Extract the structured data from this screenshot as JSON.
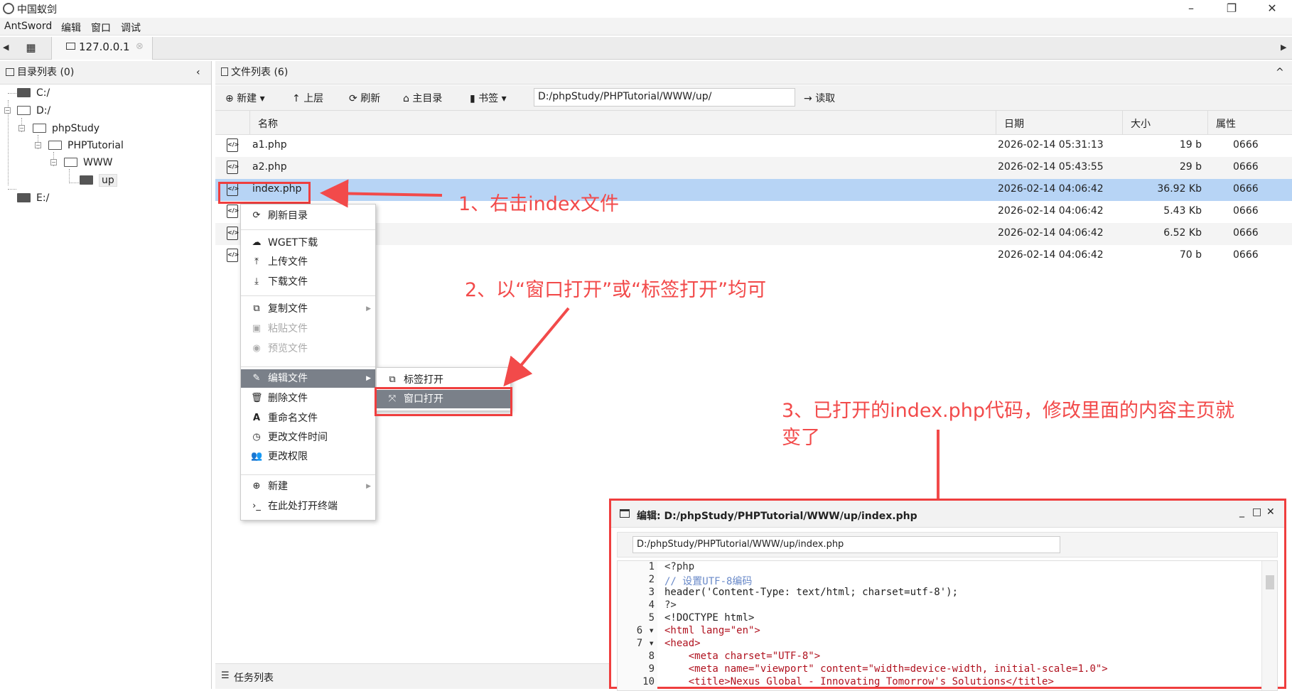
{
  "window": {
    "title": "中国蚁剑",
    "minimize": "–",
    "restore": "❐",
    "close": "✕"
  },
  "menu": [
    "AntSword",
    "编辑",
    "窗口",
    "调试"
  ],
  "tabs": {
    "host": "127.0.0.1"
  },
  "left": {
    "header": "目录列表 (0)",
    "tree": [
      "C:/",
      "D:/",
      "phpStudy",
      "PHPTutorial",
      "WWW",
      "up",
      "E:/"
    ]
  },
  "right": {
    "header": "文件列表 (6)",
    "toolbar": {
      "new": "新建",
      "up": "上层",
      "refresh": "刷新",
      "home": "主目录",
      "bookmark": "书签",
      "path": "D:/phpStudy/PHPTutorial/WWW/up/",
      "read": "读取"
    },
    "columns": [
      "名称",
      "日期",
      "大小",
      "属性"
    ],
    "files": [
      {
        "name": "a1.php",
        "date": "2026-02-14 05:31:13",
        "size": "19 b",
        "attr": "0666"
      },
      {
        "name": "a2.php",
        "date": "2026-02-14 05:43:55",
        "size": "29 b",
        "attr": "0666"
      },
      {
        "name": "index.php",
        "date": "2026-02-14 04:06:42",
        "size": "36.92 Kb",
        "attr": "0666"
      },
      {
        "name": "",
        "date": "2026-02-14 04:06:42",
        "size": "5.43 Kb",
        "attr": "0666"
      },
      {
        "name": "",
        "date": "2026-02-14 04:06:42",
        "size": "6.52 Kb",
        "attr": "0666"
      },
      {
        "name": "",
        "date": "2026-02-14 04:06:42",
        "size": "70 b",
        "attr": "0666"
      }
    ]
  },
  "context_menu": {
    "items": [
      "刷新目录",
      "WGET下载",
      "上传文件",
      "下载文件",
      "复制文件",
      "粘贴文件",
      "预览文件",
      "编辑文件",
      "删除文件",
      "重命名文件",
      "更改文件时间",
      "更改权限",
      "新建",
      "在此处打开终端"
    ],
    "submenu": [
      "标签打开",
      "窗口打开"
    ]
  },
  "annotations": {
    "step1": "1、右击index文件",
    "step2": "2、以“窗口打开”或“标签打开”均可",
    "step3_line1": "3、已打开的index.php代码，修改里面的内容主页就",
    "step3_line2": "变了"
  },
  "editor": {
    "title": "编辑: D:/phpStudy/PHPTutorial/WWW/up/index.php",
    "path": "D:/phpStudy/PHPTutorial/WWW/up/index.php",
    "lines": [
      "<?php",
      "// 设置UTF-8编码",
      "header('Content-Type: text/html; charset=utf-8');",
      "?>",
      "<!DOCTYPE html>",
      "<html lang=\"en\">",
      "<head>",
      "    <meta charset=\"UTF-8\">",
      "    <meta name=\"viewport\" content=\"width=device-width, initial-scale=1.0\">",
      "    <title>Nexus Global - Innovating Tomorrow's Solutions</title>"
    ]
  },
  "bottom": {
    "tasks": "任务列表"
  }
}
